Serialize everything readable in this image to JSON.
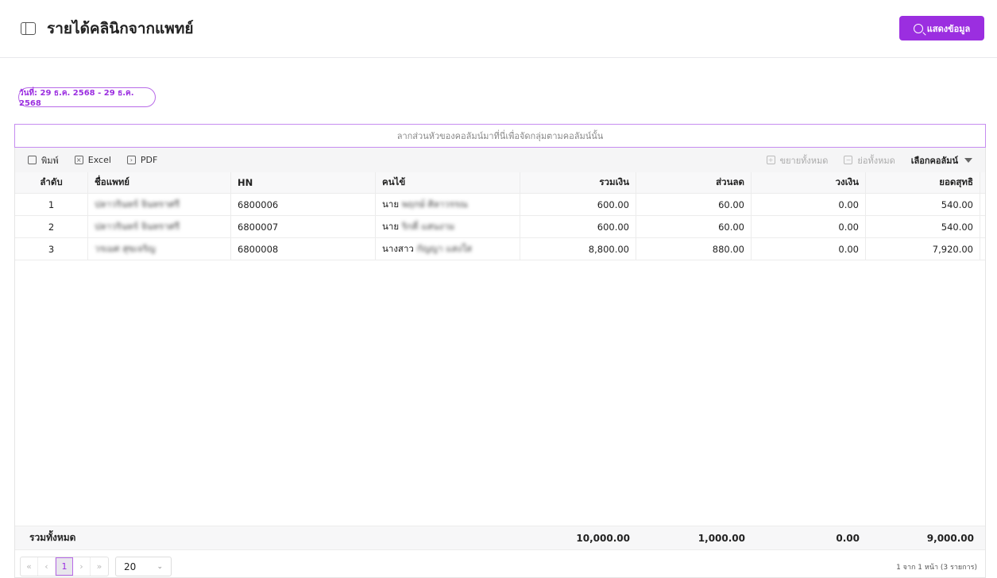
{
  "header": {
    "title": "รายได้คลินิกจากแพทย์",
    "show_button": "แสดงข้อมูล"
  },
  "date_filter": "วันที่: 29 ธ.ค. 2568 - 29 ธ.ค. 2568",
  "group_hint": "ลากส่วนหัวของคอลัมน์มาที่นี่เพื่อจัดกลุ่มตามคอลัมน์นั้น",
  "toolbar": {
    "print": "พิมพ์",
    "excel": "Excel",
    "pdf": "PDF",
    "expand_all": "ขยายทั้งหมด",
    "collapse_all": "ย่อทั้งหมด",
    "choose_columns": "เลือกคอลัมน์"
  },
  "columns": [
    "ลำดับ",
    "ชื่อแพทย์",
    "HN",
    "คนไข้",
    "รวมเงิน",
    "ส่วนลด",
    "วงเงิน",
    "ยอดสุทธิ"
  ],
  "rows": [
    [
      "1",
      "ปลาวรินทร์ จินทราศรี",
      "6800006",
      "นาย พฤกษ์ ศิลาวรรณ",
      "600.00",
      "60.00",
      "0.00",
      "540.00"
    ],
    [
      "2",
      "ปลาวรินทร์ จินทราศรี",
      "6800007",
      "นาย ริกคี่ แสนงาม",
      "600.00",
      "60.00",
      "0.00",
      "540.00"
    ],
    [
      "3",
      "วรเมศ สุขเจริญ",
      "6800008",
      "นางสาว กัญญา แสงใส",
      "8,800.00",
      "880.00",
      "0.00",
      "7,920.00"
    ]
  ],
  "totals": {
    "label": "รวมทั้งหมด",
    "sum": "10,000.00",
    "discount": "1,000.00",
    "limit": "0.00",
    "net": "9,000.00"
  },
  "pagination": {
    "first": "«",
    "prev": "‹",
    "current": "1",
    "next": "›",
    "last": "»",
    "page_size": "20",
    "info": "1 จาก 1 หน้า (3 รายการ)"
  },
  "colors": {
    "accent": "#9b2ee0"
  }
}
